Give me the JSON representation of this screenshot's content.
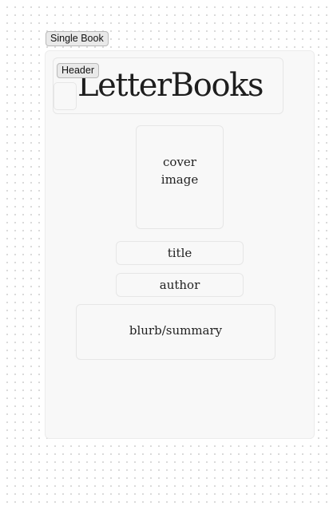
{
  "frame": {
    "label": "Single Book"
  },
  "header": {
    "label": "Header",
    "site_title": "LetterBooks",
    "logo_icon": "logo-placeholder-icon"
  },
  "book": {
    "cover": "cover image",
    "title": "title",
    "author": "author",
    "blurb": "blurb/summary"
  }
}
